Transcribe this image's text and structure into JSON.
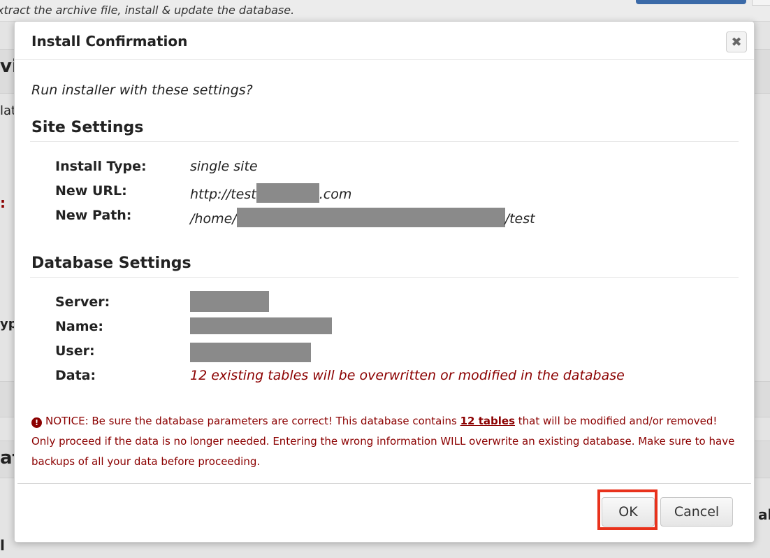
{
  "background": {
    "instruction": "xtract the archive file, install & update the database.",
    "fragments": [
      "vie",
      "lat",
      ":",
      "yp",
      "at",
      "al",
      "l"
    ]
  },
  "dialog": {
    "title": "Install Confirmation",
    "close_icon": "close-icon",
    "prompt": "Run installer with these settings?",
    "site_settings": {
      "heading": "Site Settings",
      "install_type_label": "Install Type:",
      "install_type_value": "single site",
      "new_url_label": "New URL:",
      "new_url_prefix": "http://test",
      "new_url_suffix": ".com",
      "new_path_label": "New Path:",
      "new_path_prefix": "/home/",
      "new_path_suffix": "/test"
    },
    "database_settings": {
      "heading": "Database Settings",
      "server_label": "Server:",
      "name_label": "Name:",
      "user_label": "User:",
      "data_label": "Data:",
      "data_value": "12 existing tables will be overwritten or modified in the database"
    },
    "notice": {
      "icon": "alert-circle-icon",
      "text_before": "NOTICE: Be sure the database parameters are correct! This database contains ",
      "link_text": "12 tables",
      "text_after": " that will be modified and/or removed! Only proceed if the data is no longer needed. Entering the wrong information WILL overwrite an existing database. Make sure to have backups of all your data before proceeding."
    },
    "buttons": {
      "ok_label": "OK",
      "cancel_label": "Cancel"
    }
  },
  "colors": {
    "notice_red": "#8b0000",
    "highlight_red": "#e8321c"
  }
}
